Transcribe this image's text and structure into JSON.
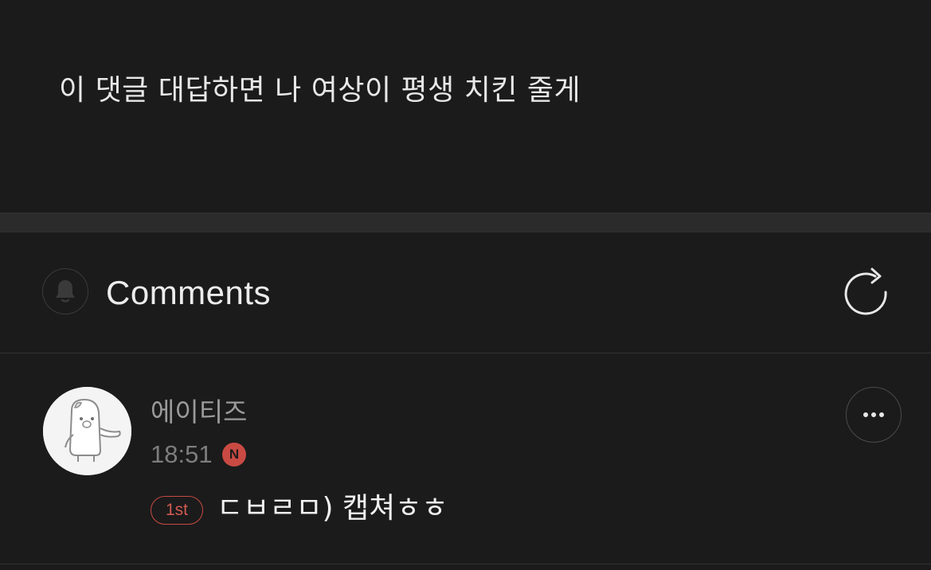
{
  "post": {
    "text": "이 댓글 대답하면 나 여상이 평생 치킨 줄게"
  },
  "comments_section": {
    "title": "Comments",
    "bell_icon": "bell-icon",
    "refresh_icon": "refresh-icon"
  },
  "comments": [
    {
      "author": "에이티즈",
      "time": "18:51",
      "new_badge": "N",
      "rank_badge": "1st",
      "text": "ㄷㅂㄹㅁ) 캡쳐ㅎㅎ",
      "more_icon": "more-dots-icon"
    }
  ],
  "colors": {
    "background": "#1b1b1b",
    "divider": "#2b2b2b",
    "accent_red": "#c94a43",
    "text_primary": "#e8e8e8",
    "text_secondary": "#9a9a9a"
  }
}
